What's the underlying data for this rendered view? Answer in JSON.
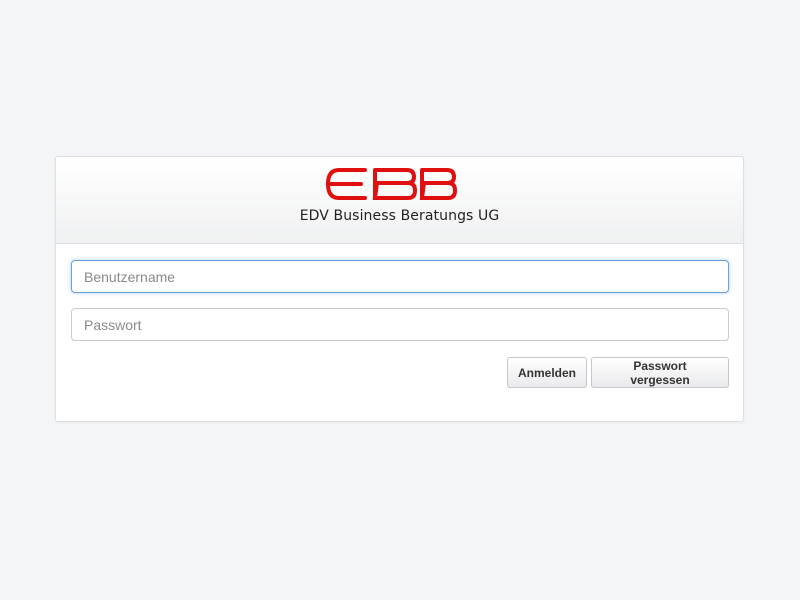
{
  "header": {
    "logo_text": "EBB",
    "company_name": "EDV Business Beratungs UG",
    "brand_color": "#e01010"
  },
  "form": {
    "username": {
      "placeholder": "Benutzername",
      "value": ""
    },
    "password": {
      "placeholder": "Passwort",
      "value": ""
    },
    "login_label": "Anmelden",
    "forgot_label": "Passwort vergessen"
  }
}
